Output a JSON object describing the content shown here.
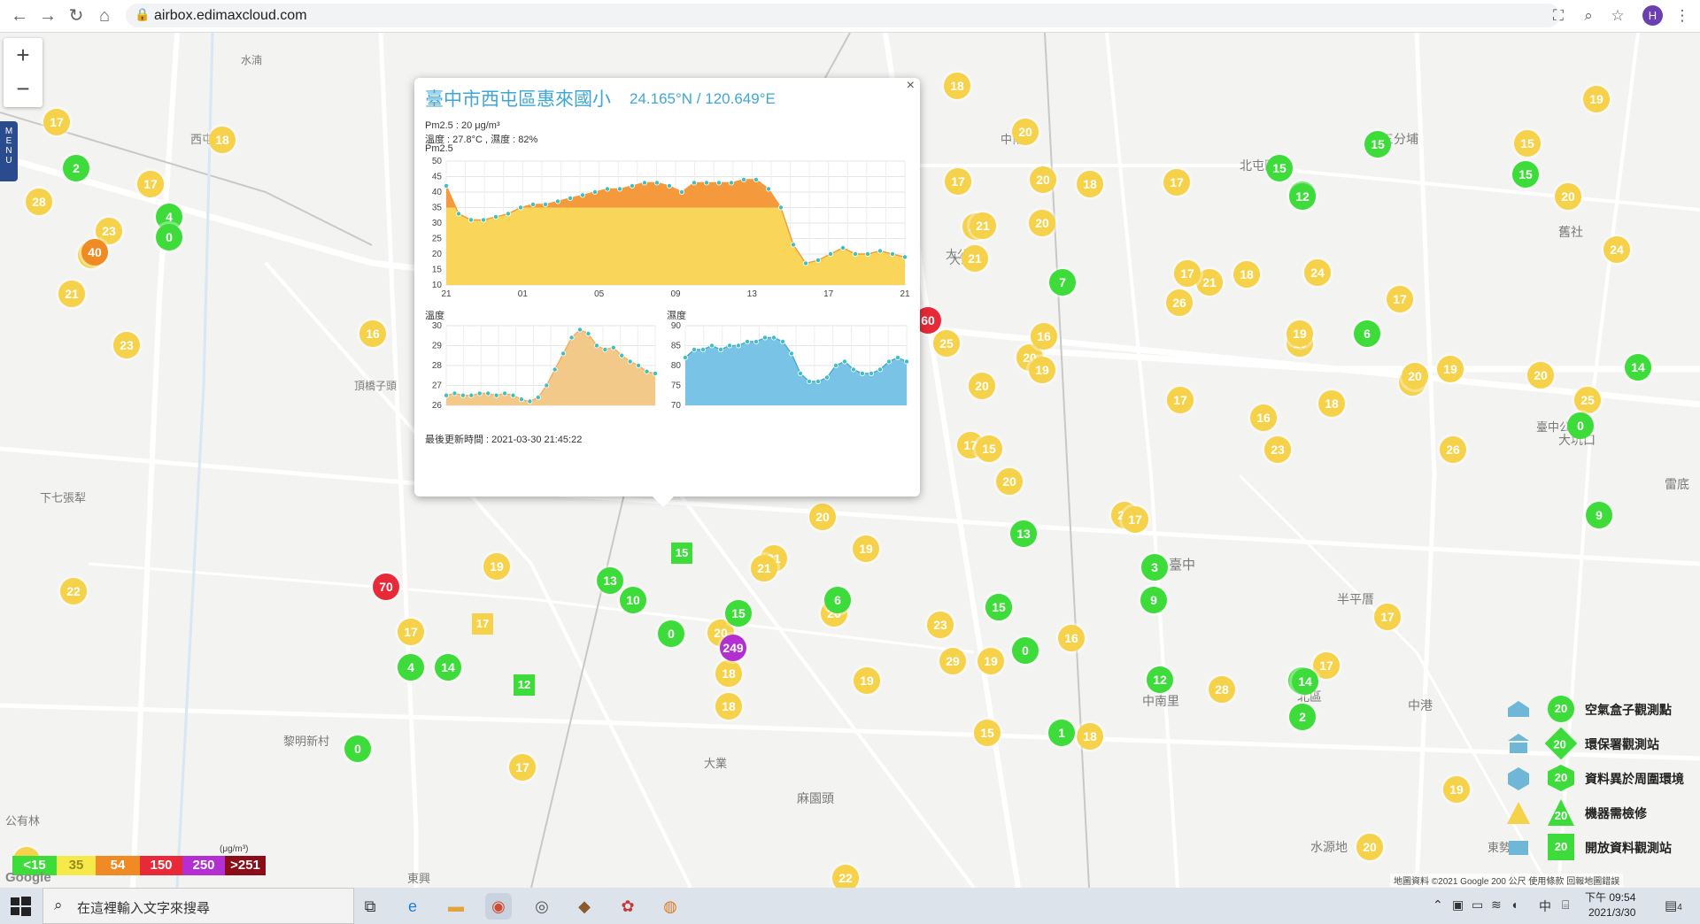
{
  "browser": {
    "url": "airbox.edimaxcloud.com",
    "profile_initial": "H",
    "icons": [
      "back-arrow-icon",
      "forward-arrow-icon",
      "reload-icon",
      "home-icon",
      "lock-icon",
      "translate-icon",
      "zoom-icon",
      "star-icon",
      "kebab-menu-icon"
    ]
  },
  "map": {
    "zoom_in": "+",
    "zoom_out": "−",
    "menu_label": "MENU",
    "place_names": [
      "水湳",
      "北屯區",
      "三分埔",
      "臺中",
      "大坑口",
      "下七張犁",
      "黎明新村",
      "中港",
      "東勢子",
      "中南里",
      "東興",
      "大業",
      "西屯",
      "麻園頭",
      "北區",
      "中甫",
      "大公",
      "半平厝",
      "臺中公",
      "水源地",
      "雷底",
      "公有林",
      "舊社",
      "大湳",
      "頂橋子頭"
    ],
    "markers_yellow": [
      "17",
      "18",
      "20",
      "17",
      "20",
      "18",
      "17",
      "21",
      "18",
      "19",
      "15",
      "20",
      "28",
      "23",
      "23",
      "21",
      "23",
      "16",
      "21",
      "25",
      "20",
      "21",
      "20",
      "16",
      "26",
      "17",
      "24",
      "17",
      "18",
      "24",
      "23",
      "20",
      "19",
      "17",
      "21",
      "17",
      "23",
      "20",
      "19",
      "18",
      "17",
      "22",
      "17",
      "20",
      "20",
      "19",
      "16",
      "15",
      "29",
      "19",
      "18",
      "16",
      "28",
      "20",
      "19",
      "17",
      "17",
      "19",
      "25",
      "26",
      "19",
      "22",
      "26",
      "22",
      "23",
      "20",
      "18",
      "15",
      "21",
      "17",
      "19",
      "20",
      "20",
      "19",
      "17",
      "18",
      "21"
    ],
    "markers_green": [
      "2",
      "4",
      "0",
      "12",
      "7",
      "15",
      "15",
      "12",
      "15",
      "6",
      "14",
      "0",
      "9",
      "13",
      "15",
      "10",
      "13",
      "6",
      "15",
      "0",
      "3",
      "9",
      "15",
      "14",
      "4",
      "14",
      "12",
      "2",
      "14",
      "0",
      "1",
      "0"
    ],
    "markers_other": {
      "orange": "40",
      "red1": "60",
      "red2": "70",
      "purple": "249"
    },
    "pin_value": "20",
    "squares": [
      "15",
      "17",
      "12"
    ]
  },
  "popup": {
    "title": "臺中市西屯區惠來國小",
    "coords": "24.165°N / 120.649°E",
    "close": "×",
    "pm25_line": "Pm2.5 : 20 μg/m³",
    "temp_line": "溫度 : 27.8°C , 濕度 : 82%",
    "chart_heading": "Pm2.5",
    "temp_heading": "溫度",
    "humid_heading": "濕度",
    "updated": "最後更新時間 : 2021-03-30 21:45:22"
  },
  "chart_data": [
    {
      "type": "area",
      "title": "Pm2.5",
      "categories": [
        "21",
        "01",
        "05",
        "09",
        "13",
        "17",
        "21"
      ],
      "ylim": [
        10,
        50
      ],
      "yticks": [
        10,
        15,
        20,
        25,
        30,
        35,
        40,
        45,
        50
      ],
      "values": [
        42,
        33,
        31,
        31,
        32,
        33,
        35,
        36,
        36,
        37,
        38,
        39,
        40,
        41,
        41,
        42,
        43,
        43,
        42,
        40,
        43,
        43,
        43,
        43,
        44,
        44,
        41,
        35,
        23,
        17,
        18,
        20,
        22,
        20,
        20,
        21,
        20,
        19
      ],
      "threshold": 35
    },
    {
      "type": "area",
      "title": "溫度",
      "ylim": [
        26,
        30
      ],
      "yticks": [
        26,
        27,
        28,
        29,
        30
      ],
      "values": [
        26.5,
        26.6,
        26.5,
        26.5,
        26.6,
        26.6,
        26.5,
        26.6,
        26.5,
        26.3,
        26.2,
        26.4,
        27.0,
        27.8,
        28.6,
        29.4,
        29.8,
        29.6,
        29.0,
        28.8,
        28.9,
        28.5,
        28.2,
        28.0,
        27.7,
        27.6
      ]
    },
    {
      "type": "area",
      "title": "濕度",
      "ylim": [
        70,
        90
      ],
      "yticks": [
        70,
        75,
        80,
        85,
        90
      ],
      "values": [
        82,
        84,
        84,
        85,
        84,
        85,
        85,
        86,
        86,
        87,
        87,
        86,
        83,
        78,
        76,
        76,
        77,
        80,
        81,
        79,
        78,
        78,
        79,
        81,
        82,
        81
      ]
    }
  ],
  "aq_legend": {
    "unit": "(μg/m³)",
    "bins": [
      {
        "label": "<15",
        "color": "#3ddc3b"
      },
      {
        "label": "35",
        "color": "#f5ea4a"
      },
      {
        "label": "54",
        "color": "#f08a24"
      },
      {
        "label": "150",
        "color": "#e8293a"
      },
      {
        "label": "250",
        "color": "#b42fd1"
      },
      {
        "label": ">251",
        "color": "#8b0d1a"
      }
    ]
  },
  "station_legend": [
    {
      "label": "空氣盒子觀測點",
      "badge": "20",
      "icon": "airbox-icon"
    },
    {
      "label": "環保署觀測站",
      "badge": "20",
      "icon": "epa-building-icon"
    },
    {
      "label": "資料異於周圍環境",
      "badge": "20",
      "icon": "anomaly-icon"
    },
    {
      "label": "機器需檢修",
      "badge": "20",
      "icon": "warning-triangle-icon"
    },
    {
      "label": "開放資料觀測站",
      "badge": "20",
      "icon": "open-data-icon"
    }
  ],
  "map_footer": {
    "google": "Google",
    "credits": "地圖資料 ©2021 Google   200 公尺   使用條款   回報地圖錯誤"
  },
  "taskbar": {
    "search_placeholder": "在這裡輸入文字來搜尋",
    "time": "下午 09:54",
    "date": "2021/3/30",
    "ime": "中",
    "notification_count": "4"
  }
}
